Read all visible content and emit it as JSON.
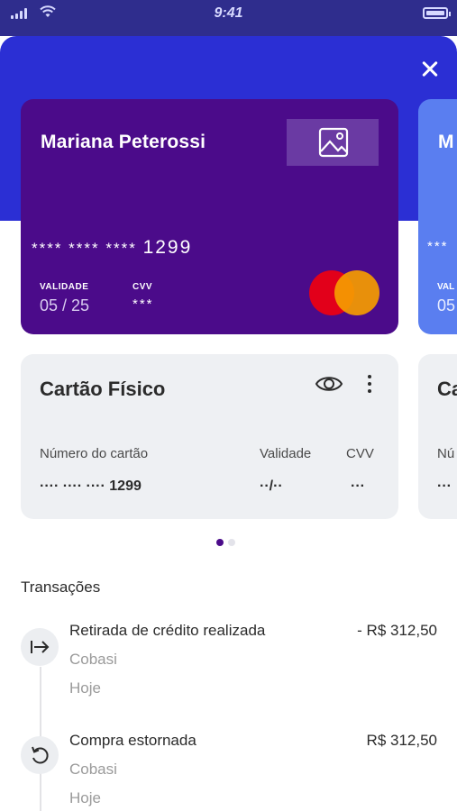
{
  "status_bar": {
    "time": "9:41"
  },
  "card": {
    "holder": "Mariana Peterossi",
    "number_masked": "**** **** ****",
    "last4": "1299",
    "validity_label": "VALIDADE",
    "validity_value": "05 / 25",
    "cvv_label": "CVV",
    "cvv_value": "***",
    "brand": "mastercard",
    "background_color": "#4b0b8a",
    "image_button_icon": "image-icon"
  },
  "next_card": {
    "holder_partial": "M",
    "stars": "***",
    "label_partial": "VAL",
    "value_partial": "05",
    "background_color": "#5a7ef0"
  },
  "physical_card": {
    "title": "Cartão Físico",
    "number_label": "Número do cartão",
    "validity_label": "Validade",
    "cvv_label": "CVV",
    "number_value": "···· ···· ···· 1299",
    "validity_value": "··/··",
    "cvv_value": "···",
    "icons": [
      "eye-icon",
      "more-vertical-icon"
    ]
  },
  "next_physical_card": {
    "title_partial": "Ca",
    "label_partial": "Nú",
    "value_partial": "···"
  },
  "pager": {
    "count": 2,
    "active_index": 0
  },
  "transactions": {
    "title": "Transações",
    "items": [
      {
        "title": "Retirada de crédito realizada",
        "merchant": "Cobasi",
        "date": "Hoje",
        "amount": "- R$ 312,50",
        "icon": "arrow-to-right-icon"
      },
      {
        "title": "Compra estornada",
        "merchant": "Cobasi",
        "date": "Hoje",
        "amount": "R$ 312,50",
        "icon": "refund-icon"
      }
    ]
  },
  "colors": {
    "header": "#2b2fd4",
    "status_bar": "#2f2d8d",
    "accent": "#4b0b8a",
    "mastercard_red": "#e2001a",
    "mastercard_orange": "#f59c00"
  }
}
